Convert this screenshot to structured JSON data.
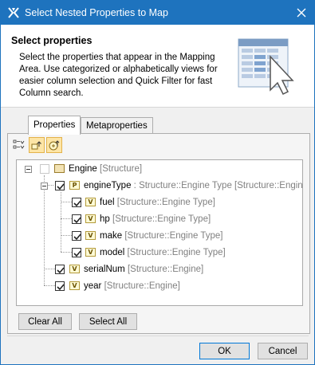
{
  "window": {
    "title": "Select Nested Properties to Map"
  },
  "header": {
    "title": "Select properties",
    "description": "Select the properties that appear in the Mapping Area. Use categorized or alphabetically views for easier column selection and Quick Filter for fast Column search."
  },
  "tabs": [
    {
      "label": "Properties",
      "active": true
    },
    {
      "label": "Metaproperties",
      "active": false
    }
  ],
  "toolbar": {
    "buttons": [
      {
        "icon": "sort-alphabetical-icon",
        "pressed": false
      },
      {
        "icon": "show-inherited-icon",
        "pressed": true
      },
      {
        "icon": "categorized-view-icon",
        "pressed": true
      }
    ]
  },
  "tree": {
    "rows": [
      {
        "name": "Engine",
        "type": "[Structure]",
        "checked": false,
        "icon": "block-icon"
      },
      {
        "name": "engineType",
        "sep": " : ",
        "typed": "Structure::Engine Type",
        "type": "[Structure::Engine]",
        "checked": true,
        "icon": "property-icon",
        "icon_letter": "P"
      },
      {
        "name": "fuel",
        "type": "[Structure::Engine Type]",
        "checked": true,
        "icon": "value-property-icon",
        "icon_letter": "V"
      },
      {
        "name": "hp",
        "type": "[Structure::Engine Type]",
        "checked": true,
        "icon": "value-property-icon",
        "icon_letter": "V"
      },
      {
        "name": "make",
        "type": "[Structure::Engine Type]",
        "checked": true,
        "icon": "value-property-icon",
        "icon_letter": "V"
      },
      {
        "name": "model",
        "type": "[Structure::Engine Type]",
        "checked": true,
        "icon": "value-property-icon",
        "icon_letter": "V"
      },
      {
        "name": "serialNum",
        "type": "[Structure::Engine]",
        "checked": true,
        "icon": "value-property-icon",
        "icon_letter": "V"
      },
      {
        "name": "year",
        "type": "[Structure::Engine]",
        "checked": true,
        "icon": "value-property-icon",
        "icon_letter": "V"
      }
    ]
  },
  "buttons": {
    "clear_all": "Clear All",
    "select_all": "Select All",
    "ok": "OK",
    "cancel": "Cancel"
  }
}
